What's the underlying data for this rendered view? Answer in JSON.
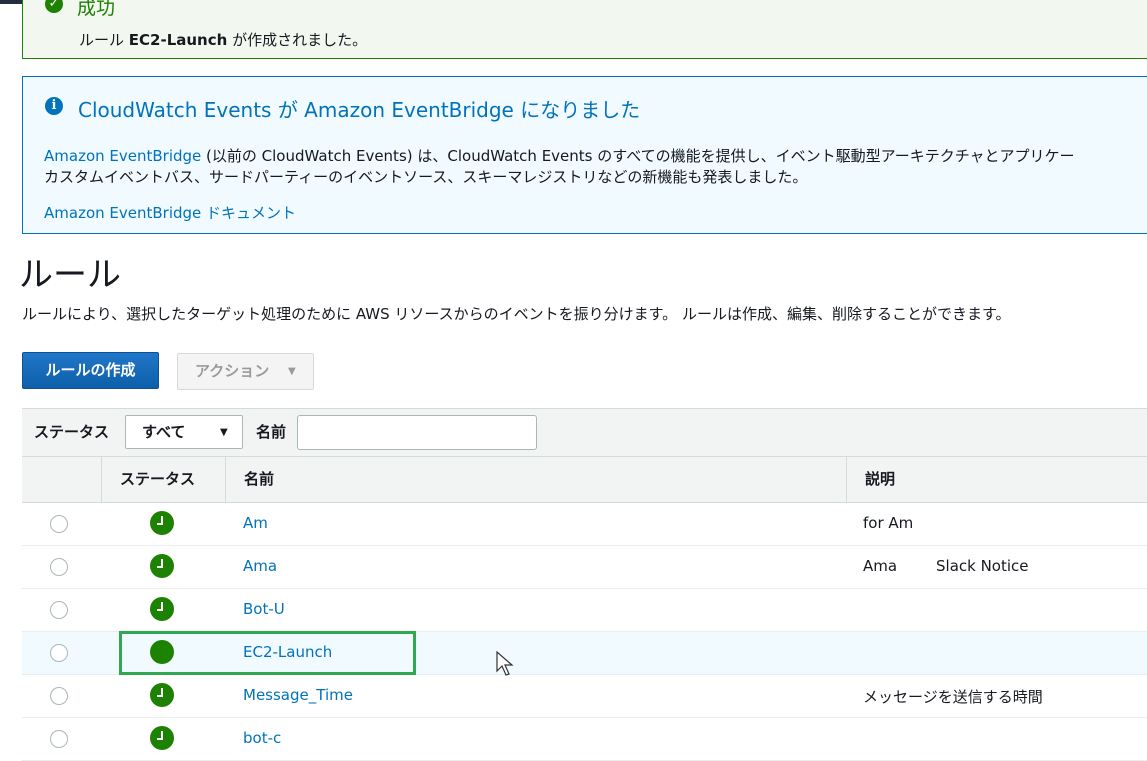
{
  "success_alert": {
    "title": "成功",
    "msg_prefix": "ルール ",
    "rule_name": "EC2-Launch",
    "msg_suffix": " が作成されました。"
  },
  "info_alert": {
    "title": "CloudWatch Events が Amazon EventBridge になりました",
    "link1": "Amazon EventBridge",
    "line1_rest": " (以前の CloudWatch Events) は、CloudWatch Events のすべての機能を提供し、イベント駆動型アーキテクチャとアプリケー",
    "line2": "カスタムイベントバス、サードパーティーのイベントソース、スキーマレジストリなどの新機能も発表しました。",
    "doc_link": "Amazon EventBridge ドキュメント"
  },
  "page": {
    "title": "ルール",
    "description": "ルールにより、選択したターゲット処理のために AWS リソースからのイベントを振り分けます。 ルールは作成、編集、削除することができます。"
  },
  "toolbar": {
    "create_label": "ルールの作成",
    "actions_label": "アクション"
  },
  "filter": {
    "status_label": "ステータス",
    "status_value": "すべて",
    "name_label": "名前",
    "name_value": ""
  },
  "table": {
    "headers": [
      "ステータス",
      "名前",
      "説明"
    ],
    "rows": [
      {
        "name": "Am",
        "description": "for Am",
        "description2": ""
      },
      {
        "name": "Ama",
        "description": "Ama",
        "description2": "Slack Notice"
      },
      {
        "name": "Bot-U",
        "description": "",
        "description2": ""
      },
      {
        "name": "EC2-Launch",
        "description": "",
        "description2": ""
      },
      {
        "name": "Message_Time",
        "description": "メッセージを送信する時間",
        "description2": ""
      },
      {
        "name": "bot-c",
        "description": "",
        "description2": ""
      }
    ]
  },
  "colors": {
    "success": "#1d8102",
    "info": "#0073bb",
    "primary_button": "#0d5fa9",
    "highlight_box": "#2fa84f"
  }
}
